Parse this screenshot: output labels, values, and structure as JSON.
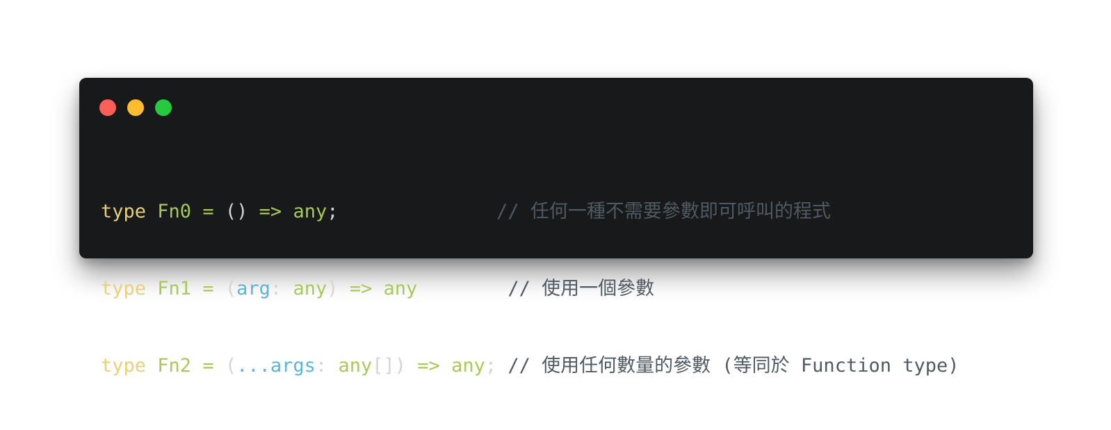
{
  "window": {
    "controls": [
      "close",
      "minimize",
      "maximize"
    ]
  },
  "code": {
    "lines": [
      {
        "keyword": "type",
        "name": "Fn0",
        "eq": "=",
        "open": "()",
        "arrow": "=>",
        "ret": "any",
        "end": ";",
        "comment": "// 任何一種不需要參數即可呼叫的程式"
      },
      {
        "keyword": "type",
        "name": "Fn1",
        "eq": "=",
        "open": "(",
        "param": "arg",
        "colon": ":",
        "param_type": "any",
        "close": ")",
        "arrow": "=>",
        "ret": "any",
        "comment": "// 使用一個參數"
      },
      {
        "keyword": "type",
        "name": "Fn2",
        "eq": "=",
        "open": "(",
        "param": "...args",
        "colon": ":",
        "param_type": "any",
        "brackets": "[]",
        "close": ")",
        "arrow": "=>",
        "ret": "any",
        "end": ";",
        "comment": "// 使用任何數量的參數 (等同於 Function type)"
      }
    ]
  },
  "colors": {
    "background": "#18191b",
    "keyword": "#e6d07a",
    "type_name": "#a8c95a",
    "parameter": "#5cb4dd",
    "punctuation": "#d4d4d4",
    "comment": "#4f5a63"
  }
}
